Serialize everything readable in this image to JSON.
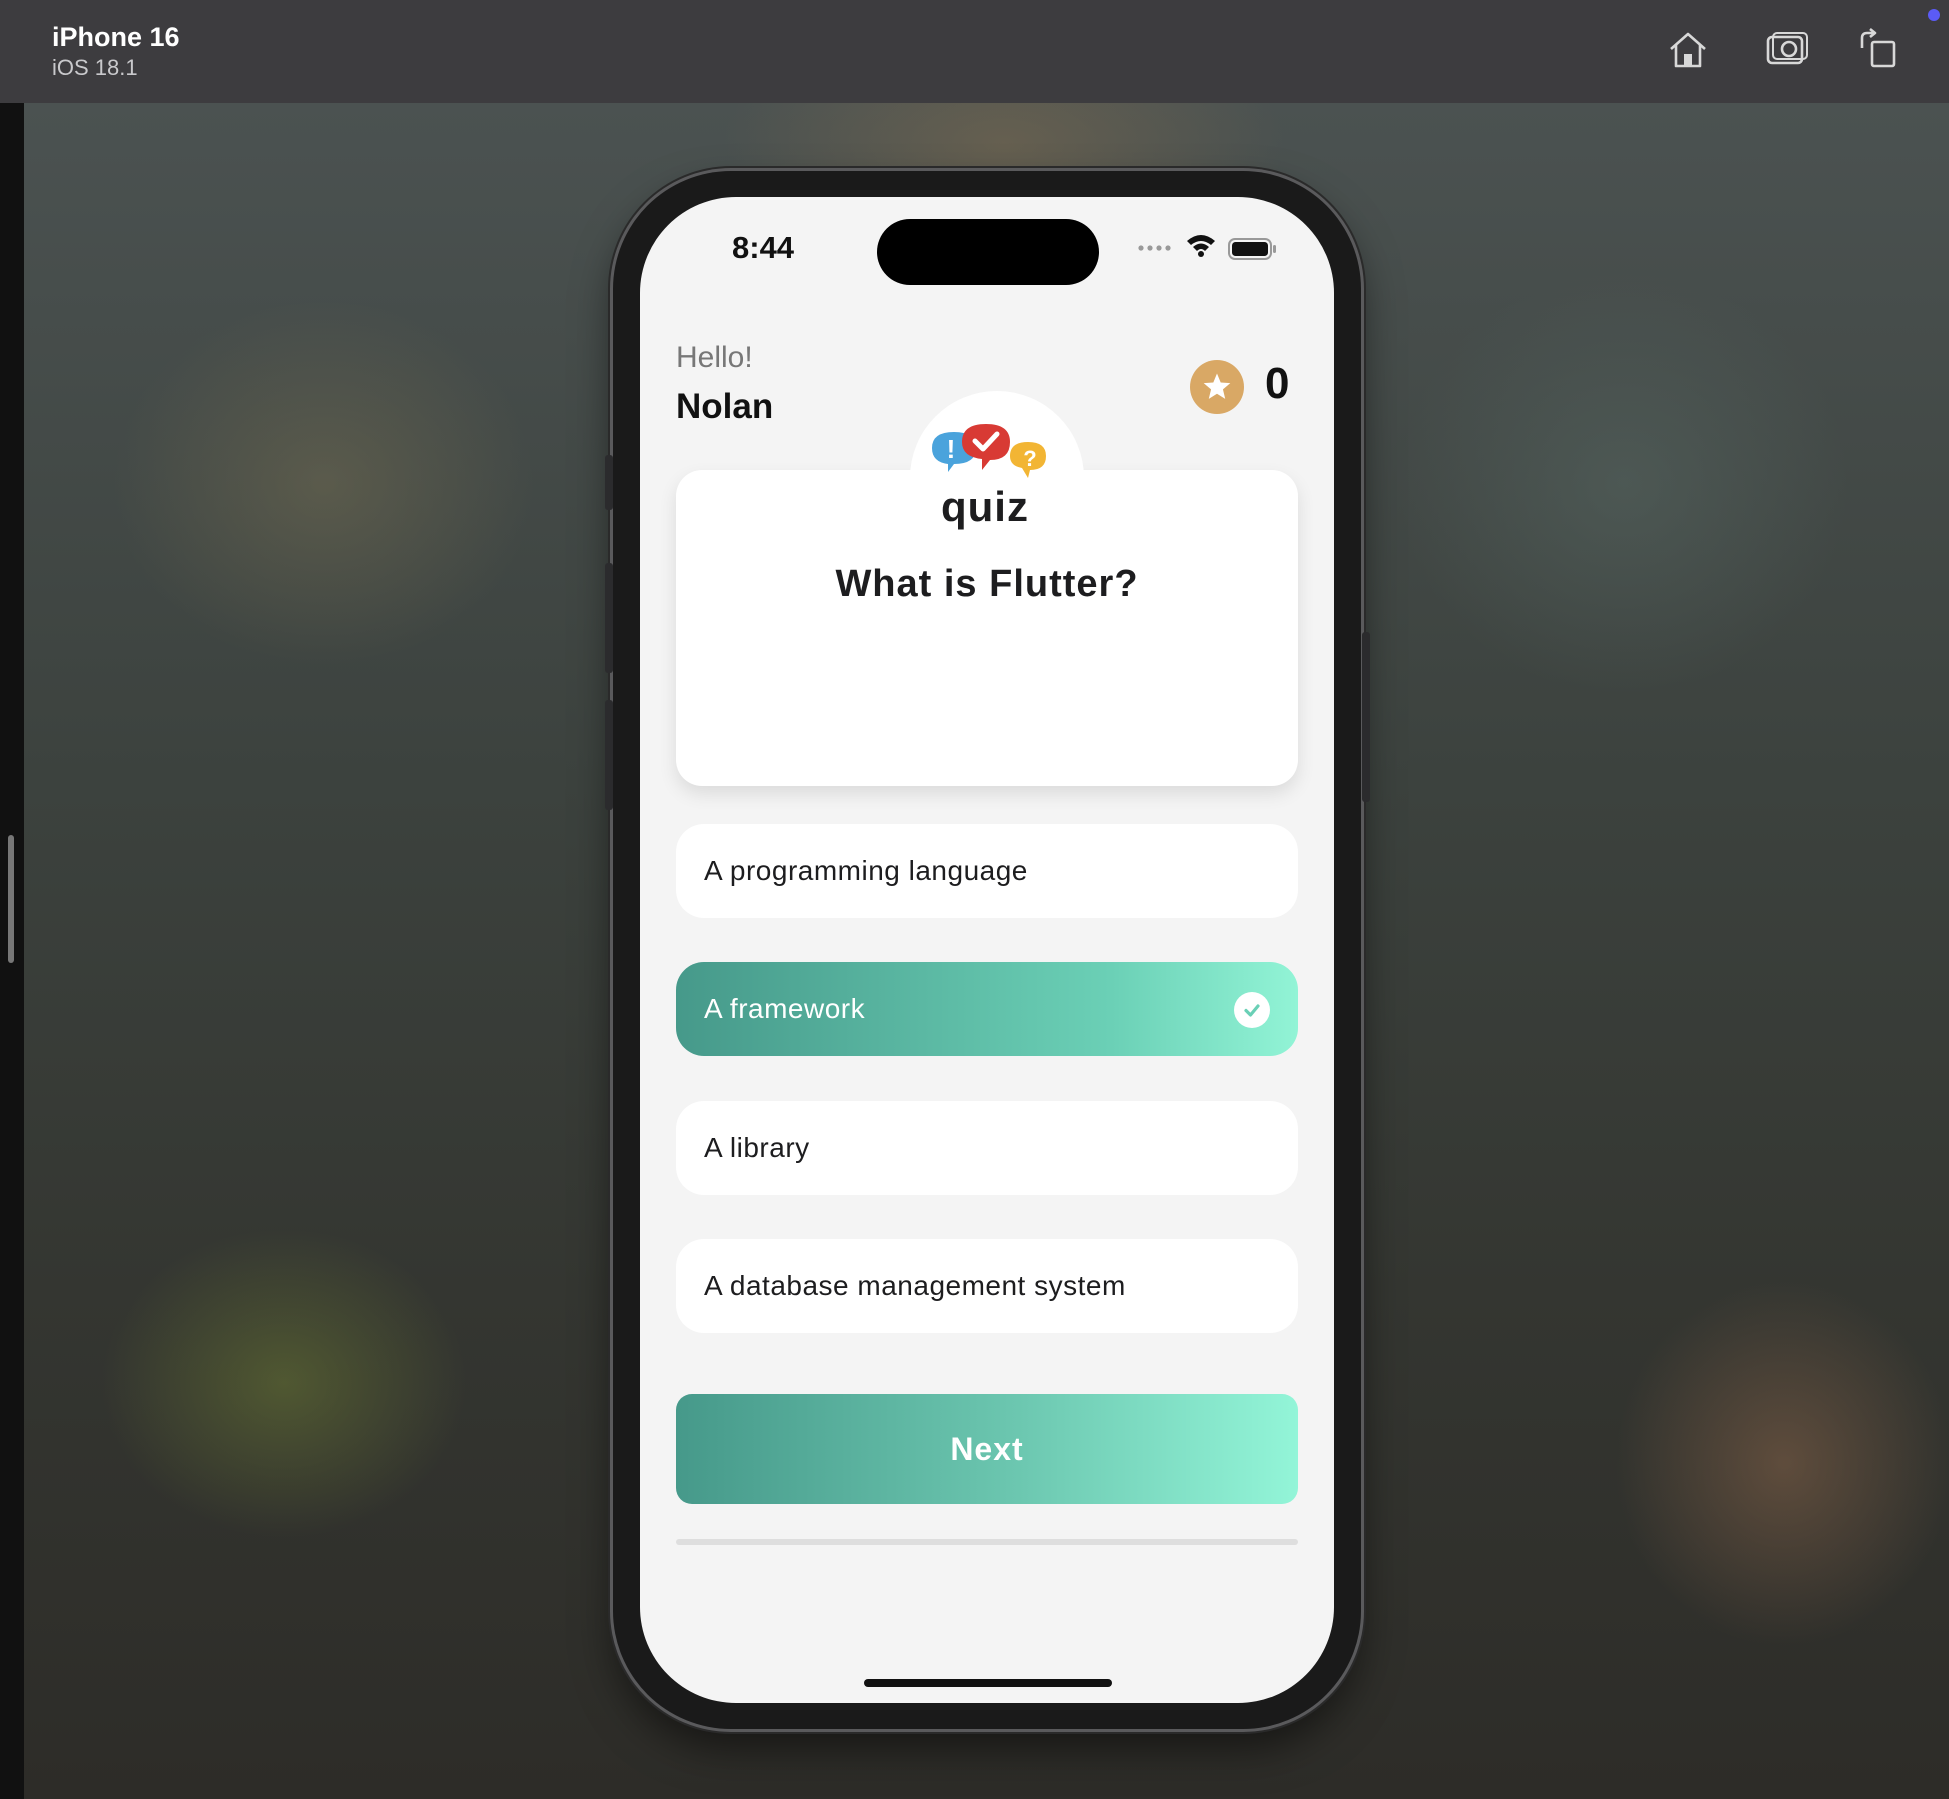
{
  "simulator": {
    "device_name": "iPhone 16",
    "os_version": "iOS 18.1",
    "toolbar": [
      "home-icon",
      "screenshot-icon",
      "rotate-icon"
    ]
  },
  "status_bar": {
    "time": "8:44"
  },
  "header": {
    "greeting": "Hello!",
    "username": "Nolan",
    "score": "0"
  },
  "logo": {
    "word": "quiz",
    "marks": [
      "!",
      "?"
    ]
  },
  "question": {
    "text": "What is Flutter?"
  },
  "options": [
    {
      "label": "A programming language",
      "selected": false
    },
    {
      "label": "A framework",
      "selected": true
    },
    {
      "label": "A library",
      "selected": false
    },
    {
      "label": "A database management system",
      "selected": false
    }
  ],
  "next_button": {
    "label": "Next"
  },
  "progress": {
    "fraction": 0
  },
  "colors": {
    "accent_start": "#46998a",
    "accent_end": "#92f4d6",
    "star_badge": "#d9a865"
  }
}
